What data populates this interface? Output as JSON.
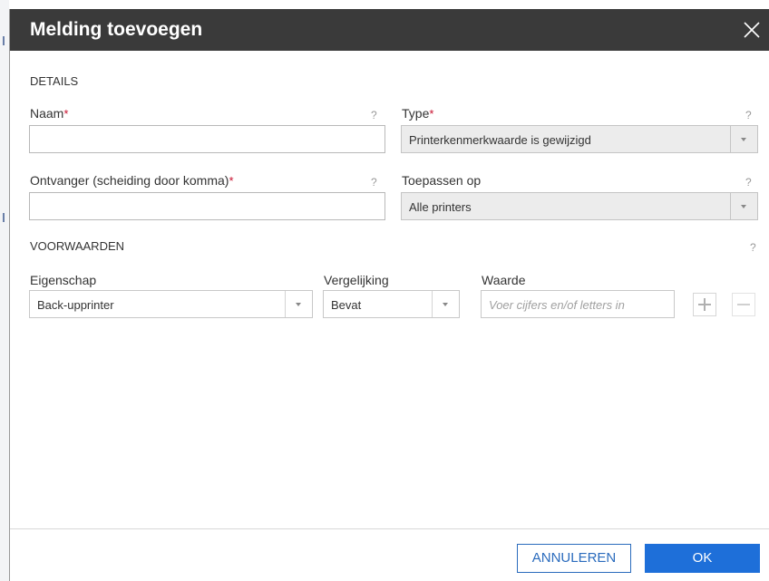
{
  "dialog": {
    "title": "Melding toevoegen",
    "close_icon": "close-icon"
  },
  "details": {
    "section_label": "DETAILS",
    "name": {
      "label": "Naam",
      "required_mark": "*",
      "help": "?",
      "value": ""
    },
    "type": {
      "label": "Type",
      "required_mark": "*",
      "help": "?",
      "selected": "Printerkenmerkwaarde is gewijzigd"
    },
    "recipient": {
      "label": "Ontvanger (scheiding door komma)",
      "required_mark": "*",
      "help": "?",
      "value": ""
    },
    "apply_to": {
      "label": "Toepassen op",
      "help": "?",
      "selected": "Alle printers"
    }
  },
  "conditions": {
    "section_label": "VOORWAARDEN",
    "help": "?",
    "property": {
      "label": "Eigenschap",
      "selected": "Back-upprinter"
    },
    "comparison": {
      "label": "Vergelijking",
      "selected": "Bevat"
    },
    "value": {
      "label": "Waarde",
      "placeholder": "Voer cijfers en/of letters in"
    },
    "add_icon": "plus-icon",
    "remove_icon": "minus-icon"
  },
  "footer": {
    "cancel_label": "ANNULEREN",
    "ok_label": "OK"
  },
  "colors": {
    "titlebar": "#3a3a3a",
    "required": "#c8102e",
    "primary": "#1e6fd9",
    "cancel_text": "#2a6bbd"
  }
}
